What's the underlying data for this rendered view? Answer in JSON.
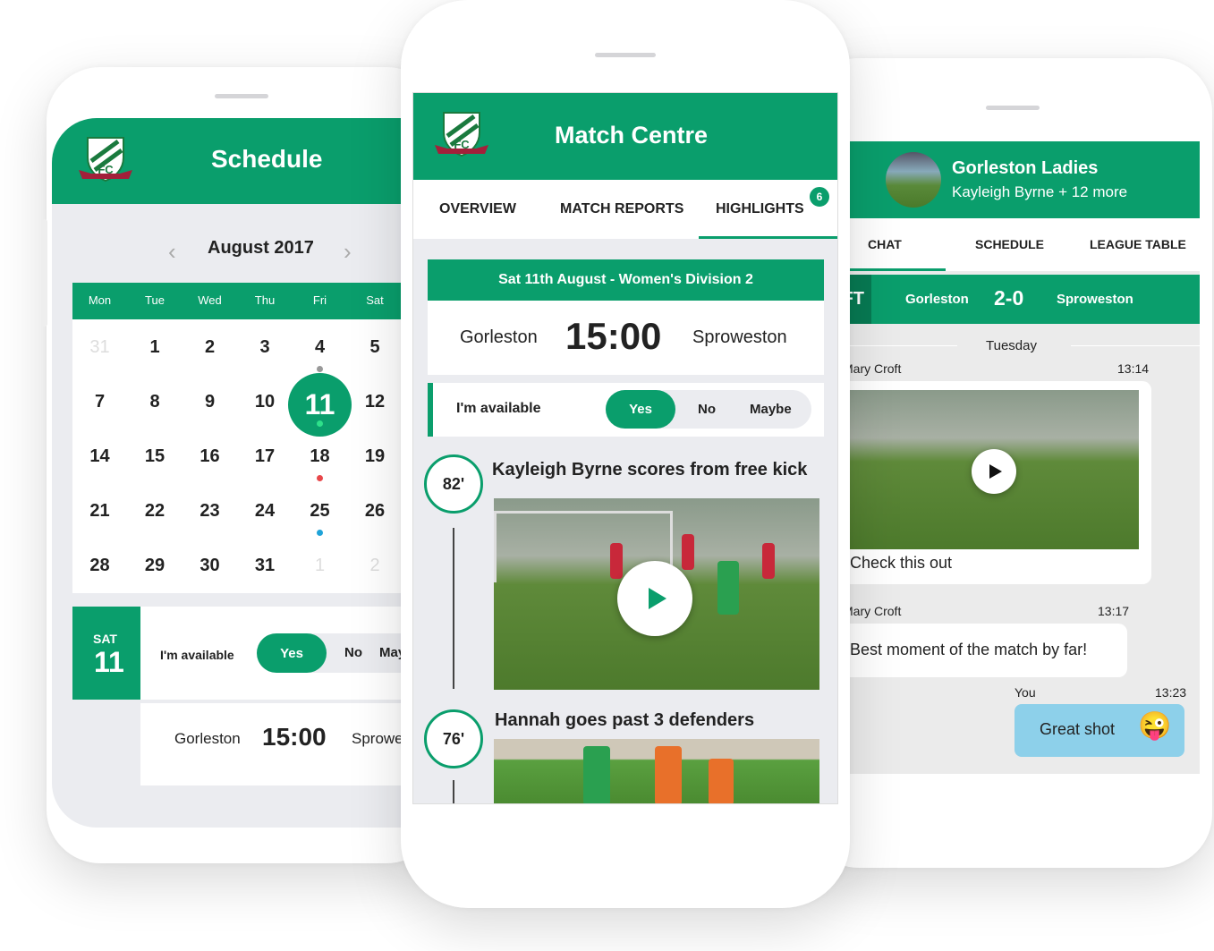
{
  "colors": {
    "brand_green": "#0a9e6c",
    "dark_green": "#077a53",
    "chat_blue": "#8dd0ea",
    "event_red": "#e8474a",
    "event_blue": "#1fa3d8"
  },
  "schedule": {
    "title": "Schedule",
    "logo_text": "GORLESTON F.C. EST. 1884",
    "month": "August 2017",
    "weekdays": [
      "Mon",
      "Tue",
      "Wed",
      "Thu",
      "Fri",
      "Sat"
    ],
    "weeks": [
      [
        "31",
        "1",
        "2",
        "3",
        "4",
        "5"
      ],
      [
        "7",
        "8",
        "9",
        "10",
        "11",
        "12"
      ],
      [
        "14",
        "15",
        "16",
        "17",
        "18",
        "19"
      ],
      [
        "21",
        "22",
        "23",
        "24",
        "25",
        "26"
      ],
      [
        "28",
        "29",
        "30",
        "31",
        "1",
        "2"
      ]
    ],
    "selected_day": "11",
    "event": {
      "day_name": "SAT",
      "day_num": "11",
      "available_label": "I'm available",
      "options": [
        "Yes",
        "No",
        "Maybe"
      ],
      "selected": "Yes",
      "home": "Gorleston",
      "time": "15:00",
      "away": "Sproweston"
    }
  },
  "match_centre": {
    "title": "Match Centre",
    "tabs": [
      "OVERVIEW",
      "MATCH REPORTS",
      "HIGHLIGHTS"
    ],
    "active_tab": "HIGHLIGHTS",
    "highlights_badge": "6",
    "fixture": {
      "header": "Sat 11th August - Women's Division 2",
      "home": "Gorleston",
      "time": "15:00",
      "away": "Sproweston"
    },
    "availability": {
      "label": "I'm available",
      "options": [
        "Yes",
        "No",
        "Maybe"
      ],
      "selected": "Yes"
    },
    "highlights": [
      {
        "minute": "82'",
        "title": "Kayleigh Byrne scores from free kick"
      },
      {
        "minute": "76'",
        "title": "Hannah goes past 3 defenders"
      }
    ]
  },
  "chat": {
    "group_name": "Gorleston Ladies",
    "members": "Kayleigh Byrne + 12 more",
    "tabs": [
      "CHAT",
      "SCHEDULE",
      "LEAGUE TABLE"
    ],
    "active_tab": "CHAT",
    "score_tag": "FT",
    "score": {
      "home": "Gorleston",
      "result": "2-0",
      "away": "Sproweston"
    },
    "day_divider": "Tuesday",
    "messages": [
      {
        "sender": "Mary Croft",
        "time": "13:14",
        "text": "Check this out",
        "has_video": true
      },
      {
        "sender": "Mary Croft",
        "time": "13:17",
        "text": "Best moment of the match by far!"
      },
      {
        "sender": "You",
        "time": "13:23",
        "text": "Great shot",
        "emoji": "😜"
      }
    ]
  }
}
